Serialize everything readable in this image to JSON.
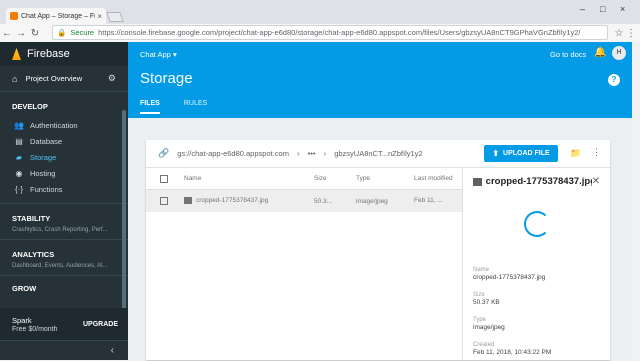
{
  "browser": {
    "tab_title": "Chat App – Storage – Fir…",
    "tab_close": "×",
    "secure_label": "Secure",
    "url": "https://console.firebase.google.com/project/chat-app-e6d80/storage/chat-app-e6d80.appspot.com/files/Users/gbzsyUA8nCT9GPhaVGnZbfIly1y2/",
    "window_controls": [
      "–",
      "□",
      "×"
    ]
  },
  "sidebar": {
    "brand": "Firebase",
    "project_overview": "Project Overview",
    "develop_header": "DEVELOP",
    "develop_items": [
      {
        "label": "Authentication",
        "icon": "people-icon"
      },
      {
        "label": "Database",
        "icon": "database-icon"
      },
      {
        "label": "Storage",
        "icon": "folder-icon",
        "active": true
      },
      {
        "label": "Hosting",
        "icon": "hosting-icon"
      },
      {
        "label": "Functions",
        "icon": "functions-icon"
      }
    ],
    "stability_header": "STABILITY",
    "stability_sub": "Crashlytics, Crash Reporting, Perf...",
    "analytics_header": "ANALYTICS",
    "analytics_sub": "Dashboard, Events, Audiences, At...",
    "grow_header": "GROW",
    "plan_name": "Spark",
    "plan_price": "Free $0/month",
    "upgrade_label": "UPGRADE",
    "collapse_icon": "‹"
  },
  "header": {
    "project_selector": "Chat App",
    "docs_link": "Go to docs",
    "avatar_letter": "H",
    "title": "Storage",
    "tabs": [
      "FILES",
      "RULES"
    ],
    "accent_color": "#039be5"
  },
  "browser_card": {
    "bucket_path": "gs://chat-app-e6d80.appspot.com",
    "ellipsis": "•••",
    "folder_crumb": "gbzsyUA8nCT...nZbfIly1y2",
    "upload_label": "UPLOAD FILE",
    "columns": {
      "name": "Name",
      "size": "Size",
      "type": "Type",
      "modified": "Last modified"
    },
    "rows": [
      {
        "name": "cropped-1775378437.jpg",
        "size": "50.3...",
        "type": "image/jpeg",
        "modified": "Feb 11, ..."
      }
    ]
  },
  "details": {
    "title": "cropped-1775378437.jpg",
    "fields": [
      {
        "label": "Name",
        "value": "cropped-1775378437.jpg"
      },
      {
        "label": "Size",
        "value": "50.37 KB"
      },
      {
        "label": "Type",
        "value": "image/jpeg"
      },
      {
        "label": "Created",
        "value": "Feb 11, 2018, 10:43:22 PM"
      }
    ]
  }
}
